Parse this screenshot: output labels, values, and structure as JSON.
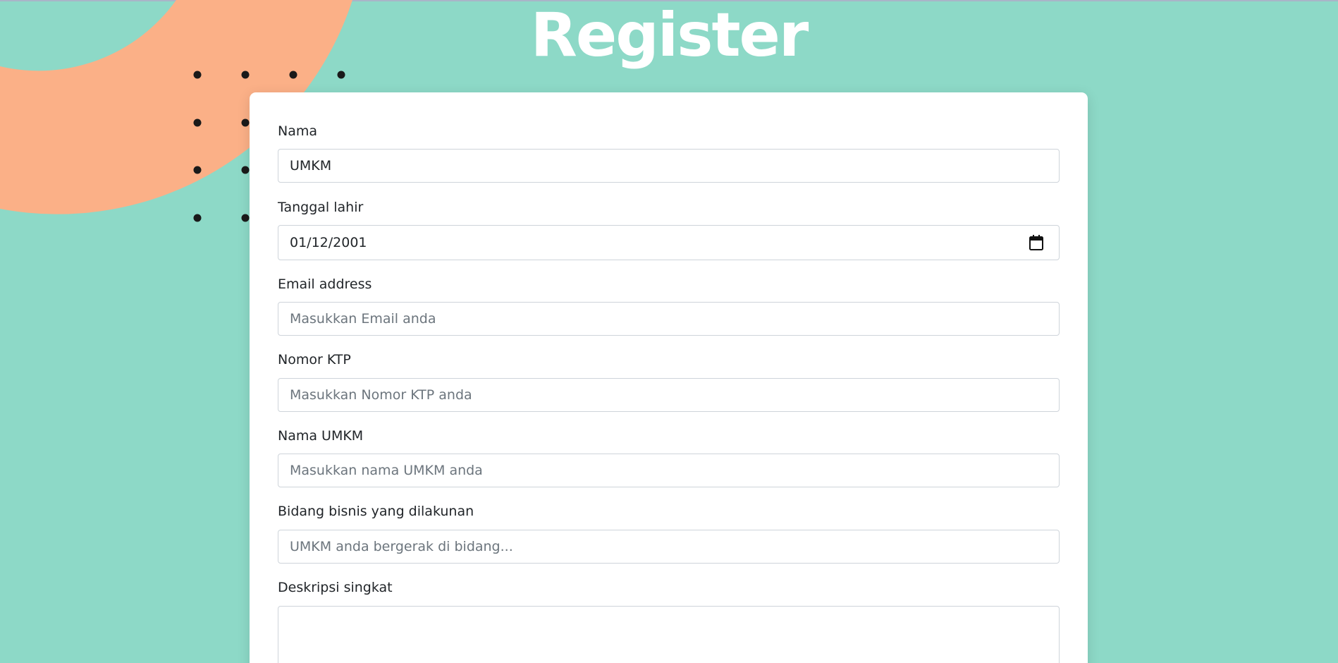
{
  "page": {
    "title": "Register"
  },
  "colors": {
    "background": "#8dd9c7",
    "accent_blob": "#fbb087",
    "dots": "#1a1a1a",
    "card": "#ffffff",
    "title": "#ffffff"
  },
  "form": {
    "nama": {
      "label": "Nama",
      "value": "UMKM"
    },
    "tanggal_lahir": {
      "label": "Tanggal lahir",
      "value": "01/12/2001",
      "icon": "calendar-icon"
    },
    "email": {
      "label": "Email address",
      "placeholder": "Masukkan Email anda"
    },
    "ktp": {
      "label": "Nomor KTP",
      "placeholder": "Masukkan Nomor KTP anda"
    },
    "nama_umkm": {
      "label": "Nama UMKM",
      "placeholder": "Masukkan nama UMKM anda"
    },
    "bidang": {
      "label": "Bidang bisnis yang dilakunan",
      "placeholder": "UMKM anda bergerak di bidang..."
    },
    "deskripsi": {
      "label": "Deskripsi singkat",
      "value": ""
    }
  }
}
